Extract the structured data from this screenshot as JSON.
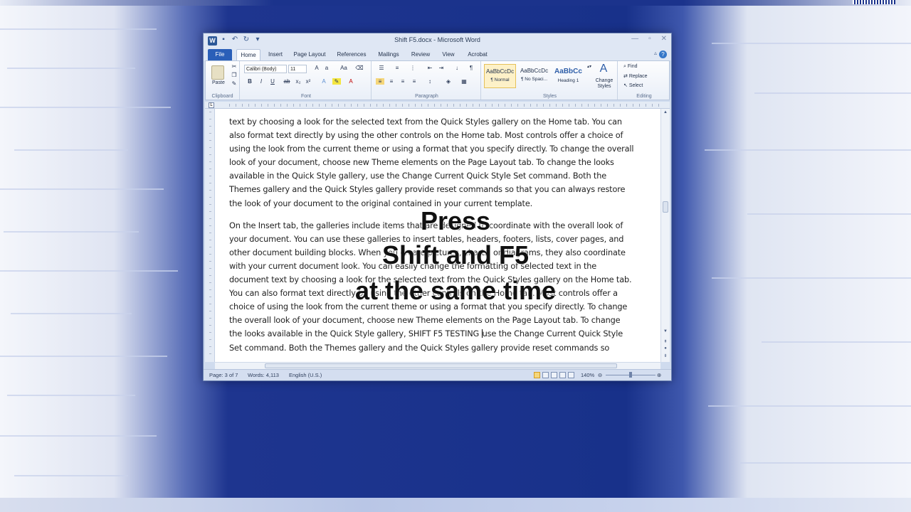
{
  "window": {
    "title": "Shift F5.docx - Microsoft Word",
    "app_icon": "W"
  },
  "tabs": [
    "File",
    "Home",
    "Insert",
    "Page Layout",
    "References",
    "Mailings",
    "Review",
    "View",
    "Acrobat"
  ],
  "ribbon": {
    "clipboard": {
      "label": "Clipboard",
      "paste": "Paste"
    },
    "font": {
      "label": "Font",
      "name": "Calibri (Body)",
      "size": "11"
    },
    "paragraph": {
      "label": "Paragraph"
    },
    "styles": {
      "label": "Styles",
      "items": [
        {
          "sample": "AaBbCcDc",
          "name": "¶ Normal"
        },
        {
          "sample": "AaBbCcDc",
          "name": "¶ No Spaci..."
        },
        {
          "sample": "AaBbCc",
          "name": "Heading 1"
        }
      ],
      "change_styles": "Change Styles"
    },
    "editing": {
      "label": "Editing",
      "find": "Find",
      "replace": "Replace",
      "select": "Select"
    }
  },
  "document": {
    "para1": "text by choosing a look for the selected text from the Quick Styles gallery on the Home tab. You can also format text directly by using the other controls on the Home tab. Most controls offer a choice of using the look from the current theme or using a format that you specify directly. To change the overall look of your document, choose new Theme elements on the Page Layout tab. To change the looks available in the Quick Style gallery, use the Change Current Quick Style Set command. Both the Themes gallery and the Quick Styles gallery provide reset commands so that you can always restore the look of your document to the original contained in your current template.",
    "para2_before_caret": "On the Insert tab, the galleries include items that are designed to coordinate with the overall look of your document. You can use these galleries to insert tables, headers, footers, lists, cover pages, and other document building blocks. When you create pictures, charts, or diagrams, they also coordinate with your current document look. You can easily change the formatting of selected text in the document text by choosing a look for the selected text from the Quick Styles gallery on the Home tab. You can also format text directly by using the other controls on the Home tab. Most controls offer a choice of using the look from the current theme or using a format that you specify directly. To change the overall look of your document, choose new Theme elements on the Page Layout tab. To change the looks available in the Quick Style gallery, SHIFT F5 TESTING ",
    "para2_after_caret": "use the Change Current Quick Style Set command. Both the Themes gallery and the Quick Styles gallery provide reset commands so"
  },
  "status": {
    "page": "Page: 3 of 7",
    "words": "Words: 4,113",
    "language": "English (U.S.)",
    "zoom": "140%"
  },
  "overlay": {
    "line1": "Press",
    "line2": "Shift and F5",
    "line3": "at the same time"
  }
}
